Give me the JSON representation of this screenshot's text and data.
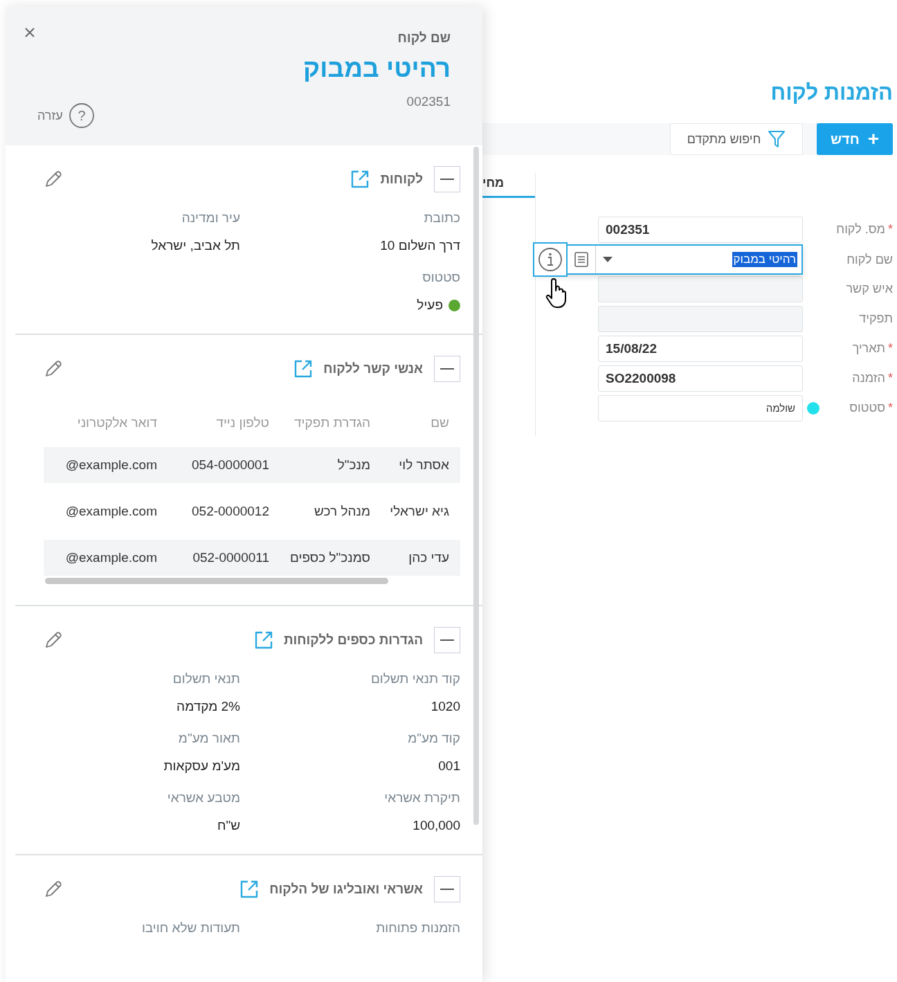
{
  "background_page": {
    "title": "הזמנות לקוח",
    "new_button": {
      "icon": "+",
      "label": "חדש"
    },
    "search_button": "חיפוש מתקדם",
    "tab": {
      "label": "מחי",
      "selected": true
    },
    "form": [
      {
        "label": "מס. לקוח",
        "required_mark": "*",
        "kind": "text",
        "value": "002351"
      },
      {
        "label": "שם לקוח",
        "kind": "dropdown",
        "value": "רהיטי במבוק"
      },
      {
        "label": "איש קשר",
        "kind": "disabled"
      },
      {
        "label": "תפקיד",
        "kind": "disabled"
      },
      {
        "label": "תאריך",
        "required_mark": "*",
        "kind": "text",
        "value": "15/08/22"
      },
      {
        "label": "הזמנה",
        "required_mark": "*",
        "kind": "text",
        "value": "SO2200098"
      },
      {
        "label": "סטטוס",
        "required_mark": "*",
        "kind": "status",
        "value": "שולמה",
        "color": "#22e0ec"
      }
    ]
  },
  "panel": {
    "label": "שם לקוח",
    "name": "רהיטי במבוק",
    "number": "002351",
    "help_icon": "?",
    "help": "עזרה",
    "sections": [
      {
        "title": "לקוחות",
        "kind": "fields",
        "expanded": true,
        "fields": [
          {
            "label": "כתובת",
            "value": "דרך השלום 10"
          },
          {
            "label": "עיר ומדינה",
            "value": "תל אביב, ישראל"
          },
          {
            "label": "סטטוס",
            "value": "פעיל",
            "color": "#5aa832"
          }
        ]
      },
      {
        "title": "אנשי קשר ללקוח",
        "kind": "table",
        "expanded": true,
        "columns": [
          "שם",
          "הגדרת תפקיד",
          "טלפון נייד",
          "דואר אלקטרוני"
        ],
        "rows": [
          [
            "אסתר לוי",
            "מנכ\"ל",
            "054-0000001",
            "@example.com"
          ],
          [
            "גיא ישראלי",
            "מנהל רכש",
            "052-0000012",
            "@example.com"
          ],
          [
            "עדי כהן",
            "סמנכ\"ל כספים",
            "052-0000011",
            "@example.com"
          ]
        ]
      },
      {
        "title": "הגדרות כספים ללקוחות",
        "kind": "fields",
        "expanded": true,
        "fields": [
          {
            "label": "קוד תנאי תשלום",
            "value": "1020"
          },
          {
            "label": "תנאי תשלום",
            "value": "2% מקדמה"
          },
          {
            "label": "קוד מע\"מ",
            "value": "001"
          },
          {
            "label": "תאור מע\"מ",
            "value": "מע'מ עסקאות"
          },
          {
            "label": "תיקרת אשראי",
            "value": "100,000"
          },
          {
            "label": "מטבע אשראי",
            "value": "ש\"ח"
          }
        ]
      },
      {
        "title": "אשראי ואובליגו של הלקוח",
        "kind": "fields",
        "expanded": true,
        "fields": [
          {
            "label": "הזמנות פתוחות"
          },
          {
            "label": "תעודות שלא חויבו"
          }
        ]
      }
    ]
  }
}
